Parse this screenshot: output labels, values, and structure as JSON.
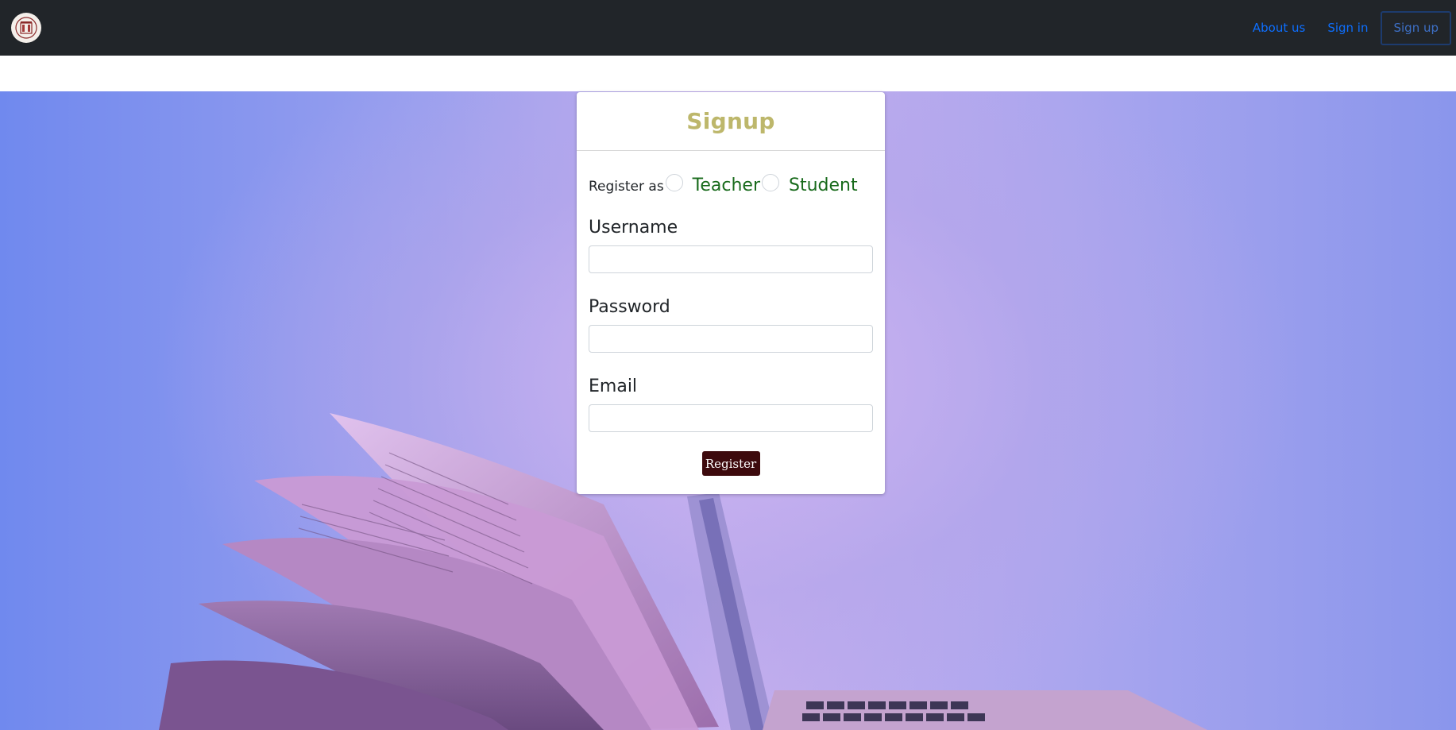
{
  "navbar": {
    "logo_alt": "logo",
    "links": {
      "about": "About us",
      "signin": "Sign in",
      "signup": "Sign up"
    }
  },
  "signup": {
    "title": "Signup",
    "register_as": "Register as",
    "roles": {
      "teacher": "Teacher",
      "student": "Student"
    },
    "fields": {
      "username": {
        "label": "Username",
        "value": ""
      },
      "password": {
        "label": "Password",
        "value": ""
      },
      "email": {
        "label": "Email",
        "value": ""
      }
    },
    "submit": "Register"
  },
  "colors": {
    "navbar_bg": "#212529",
    "link": "#0d6efd",
    "title": "#bdb76b",
    "role_text": "#196b1c",
    "button_bg": "#3d0a0d"
  },
  "background_image": "open-book-and-laptop"
}
